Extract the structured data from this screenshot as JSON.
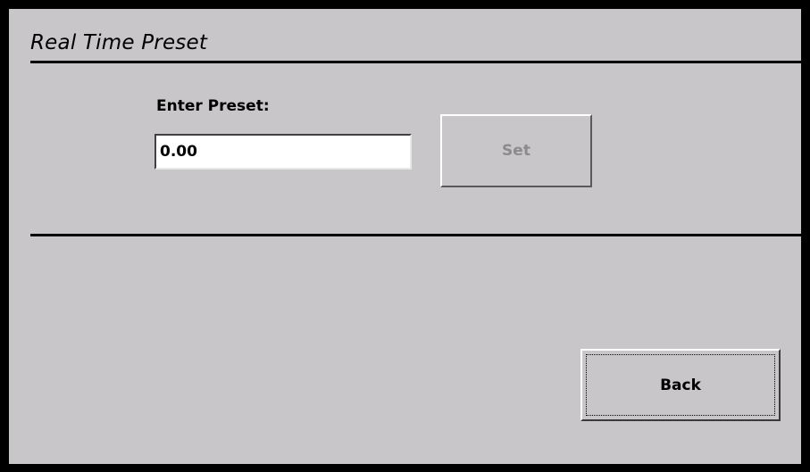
{
  "window": {
    "title": "Real Time Preset"
  },
  "preset": {
    "label": "Enter Preset:",
    "value": "0.00"
  },
  "buttons": {
    "set_label": "Set",
    "set_enabled": false,
    "back_label": "Back"
  },
  "colors": {
    "background": "#c8c6c9",
    "frame": "#000000",
    "disabled_text": "#8c8a8d"
  }
}
